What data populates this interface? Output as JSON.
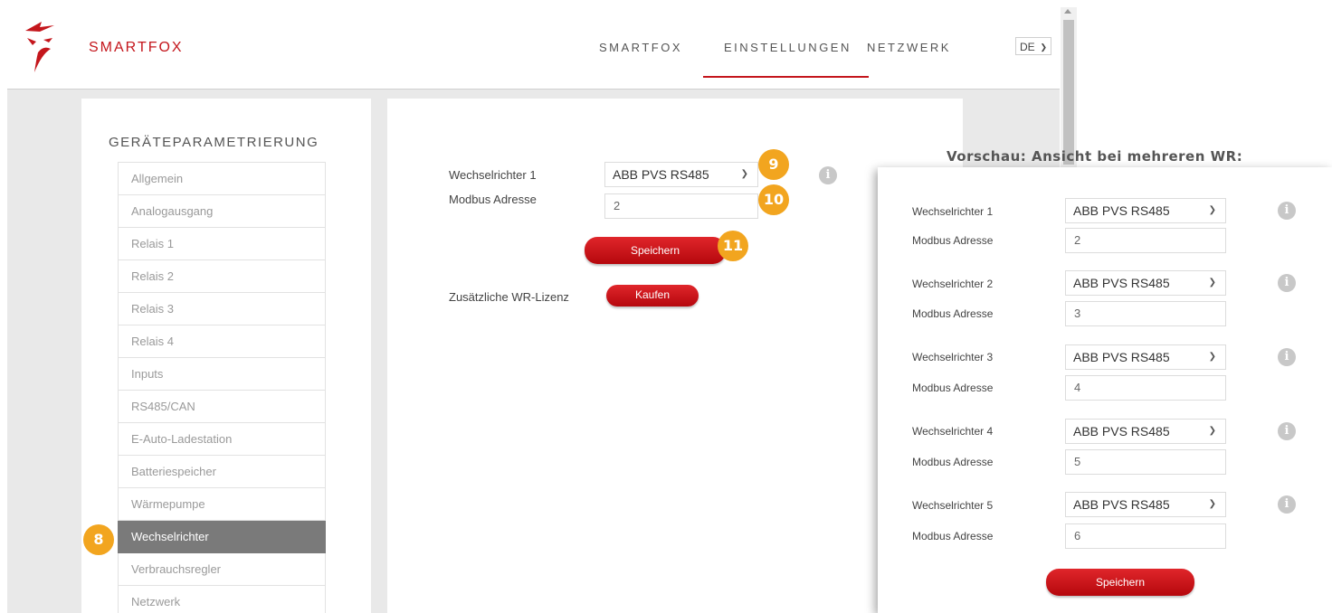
{
  "header": {
    "brand": "SMARTFOX",
    "nav": [
      "SMARTFOX",
      "EINSTELLUNGEN",
      "NETZWERK"
    ],
    "active_nav": "EINSTELLUNGEN",
    "language": "DE"
  },
  "sidebar": {
    "title": "GERÄTEPARAMETRIERUNG",
    "items": [
      {
        "label": "Allgemein"
      },
      {
        "label": "Analogausgang"
      },
      {
        "label": "Relais 1"
      },
      {
        "label": "Relais 2"
      },
      {
        "label": "Relais 3"
      },
      {
        "label": "Relais 4"
      },
      {
        "label": "Inputs"
      },
      {
        "label": "RS485/CAN"
      },
      {
        "label": "E-Auto-Ladestation"
      },
      {
        "label": "Batteriespeicher"
      },
      {
        "label": "Wärmepumpe"
      },
      {
        "label": "Wechselrichter"
      },
      {
        "label": "Verbrauchsregler"
      },
      {
        "label": "Netzwerk"
      }
    ],
    "active_item": "Wechselrichter"
  },
  "main": {
    "inverter_label": "Wechselrichter 1",
    "inverter_value": "ABB PVS RS485",
    "modbus_label": "Modbus Adresse",
    "modbus_value": "2",
    "save_label": "Speichern",
    "license_label": "Zusätzliche WR-Lizenz",
    "buy_label": "Kaufen",
    "info_icon": "i"
  },
  "badges": {
    "b8": "8",
    "b9": "9",
    "b10": "10",
    "b11": "11"
  },
  "preview": {
    "title": "Vorschau: Ansicht bei mehreren WR:",
    "rows": [
      {
        "inverter_label": "Wechselrichter 1",
        "inverter_value": "ABB PVS RS485",
        "modbus_label": "Modbus Adresse",
        "modbus_value": "2"
      },
      {
        "inverter_label": "Wechselrichter 2",
        "inverter_value": "ABB PVS RS485",
        "modbus_label": "Modbus Adresse",
        "modbus_value": "3"
      },
      {
        "inverter_label": "Wechselrichter 3",
        "inverter_value": "ABB PVS RS485",
        "modbus_label": "Modbus Adresse",
        "modbus_value": "4"
      },
      {
        "inverter_label": "Wechselrichter 4",
        "inverter_value": "ABB PVS RS485",
        "modbus_label": "Modbus Adresse",
        "modbus_value": "5"
      },
      {
        "inverter_label": "Wechselrichter 5",
        "inverter_value": "ABB PVS RS485",
        "modbus_label": "Modbus Adresse",
        "modbus_value": "6"
      }
    ],
    "save_label": "Speichern"
  },
  "colors": {
    "brand_red": "#c4161c",
    "badge_orange": "#f2a51f",
    "active_item_bg": "#7a7a7a"
  }
}
